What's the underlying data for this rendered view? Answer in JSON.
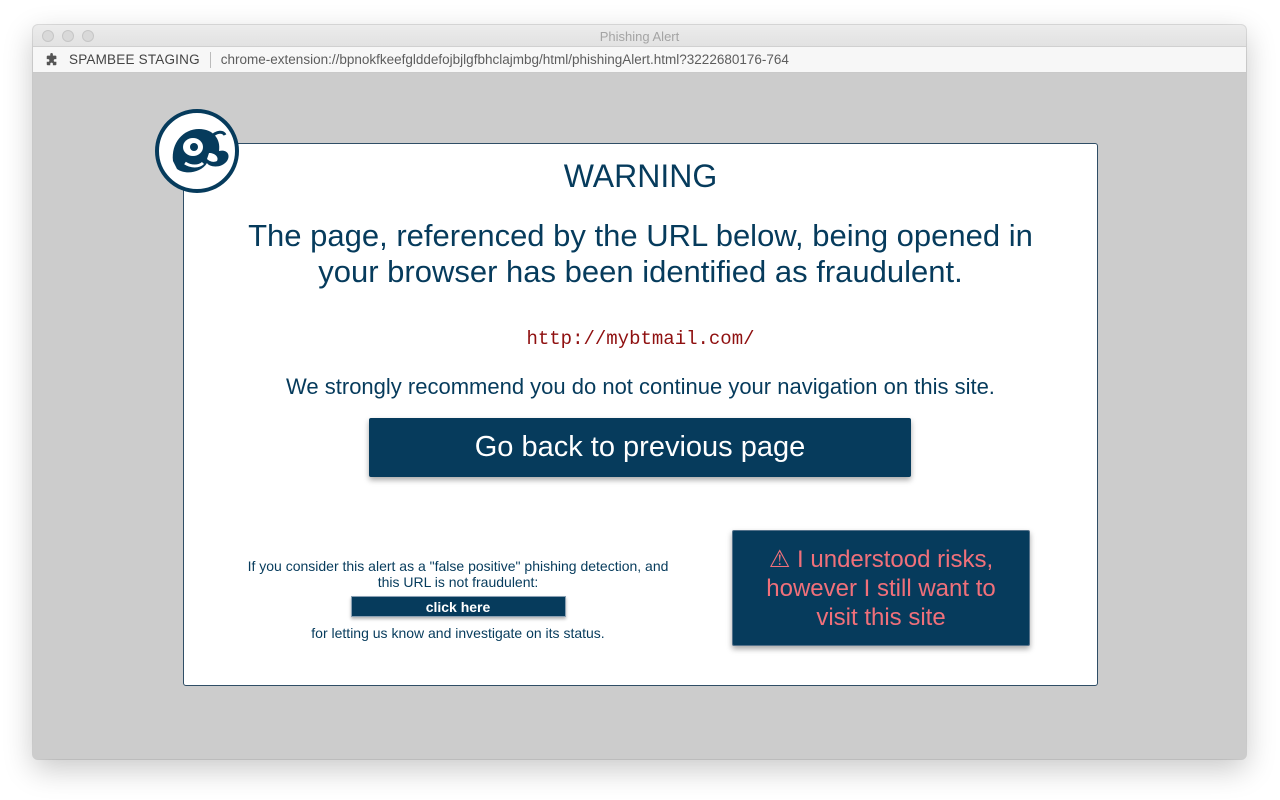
{
  "window": {
    "title": "Phishing Alert"
  },
  "addressbar": {
    "extension_name": "SPAMBEE STAGING",
    "url": "chrome-extension://bpnokfkeefglddefojbjlgfbhclajmbg/html/phishingAlert.html?3222680176-764"
  },
  "alert": {
    "title": "WARNING",
    "message": "The page, referenced by the URL below, being opened in your browser has been identified as fraudulent.",
    "fraud_url": "http://mybtmail.com/",
    "recommendation": "We strongly recommend you do not continue your navigation on this site.",
    "back_button_label": "Go back to previous page",
    "false_positive_text": "If you consider this alert as a \"false positive\" phishing detection, and this URL is not fraudulent:",
    "click_here_label": "click here",
    "investigate_text": "for letting us know and investigate on its status.",
    "proceed_button_label": "⚠ I understood risks, however I still want to visit this site"
  },
  "colors": {
    "brand_navy": "#063b5c",
    "url_red": "#8f1010",
    "risk_text": "#f0707a",
    "page_background": "#cccccc"
  },
  "icons": {
    "logo": "spambee-bird-logo",
    "extension": "puzzle-piece-icon"
  }
}
